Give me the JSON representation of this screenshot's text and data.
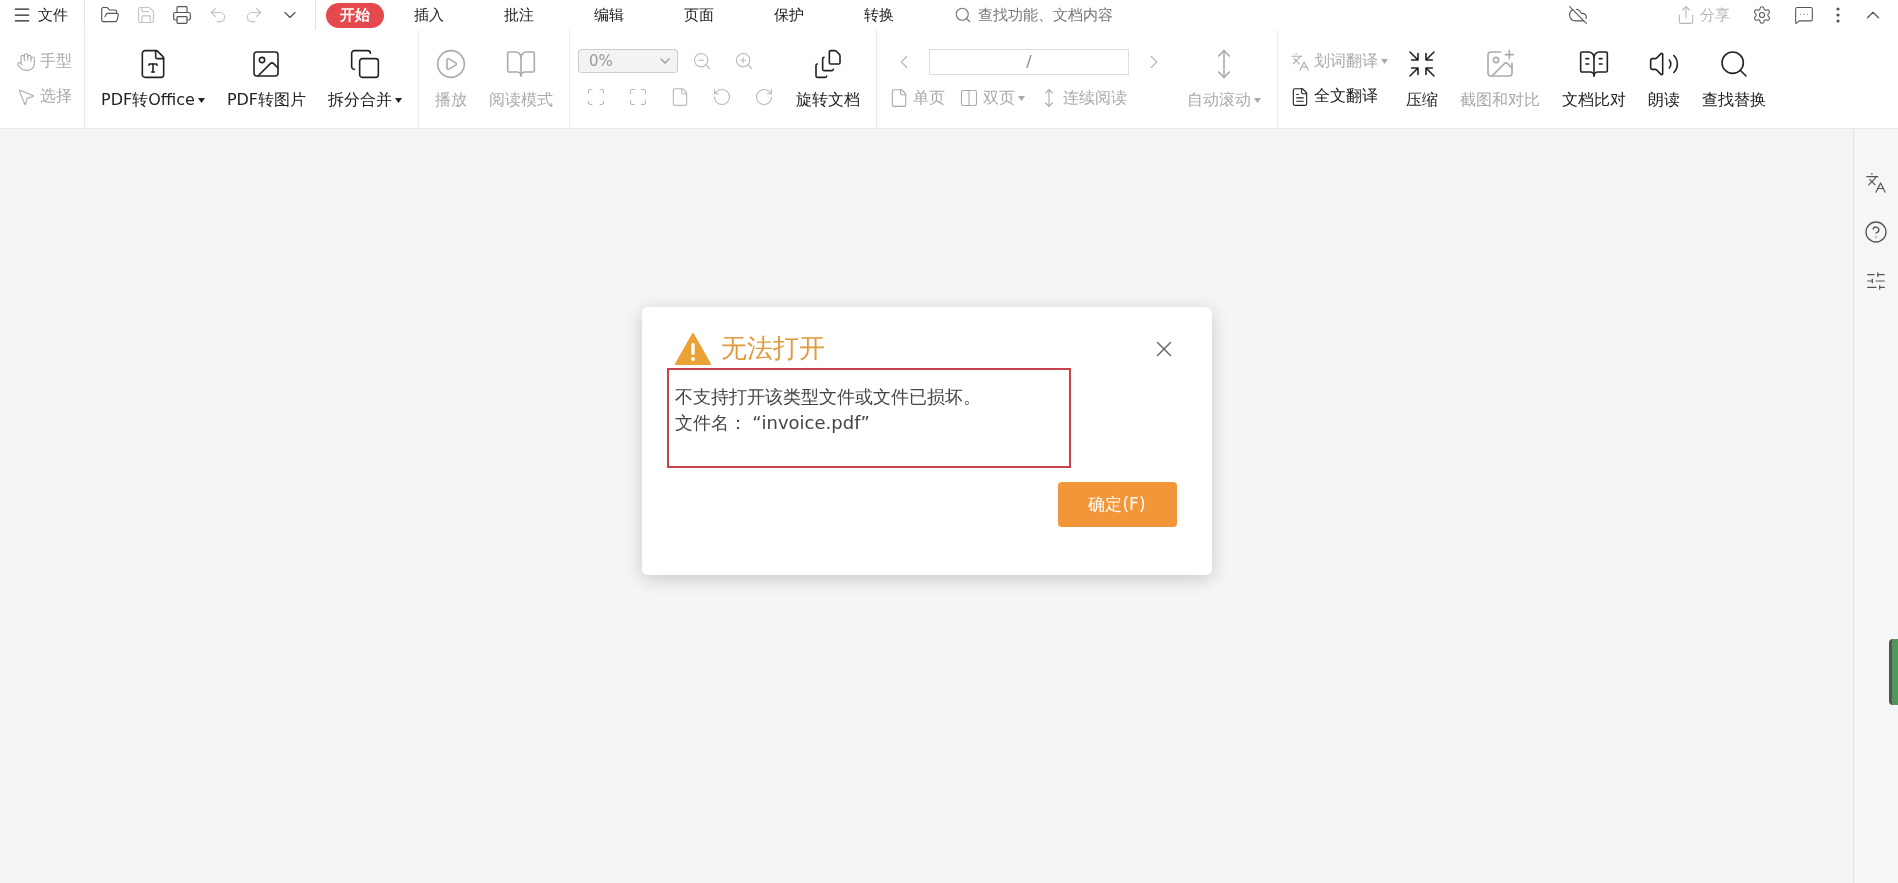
{
  "menu": {
    "label": "文件"
  },
  "quick_tools": [
    {
      "disabled": false
    },
    {
      "disabled": true
    },
    {
      "disabled": false
    },
    {
      "disabled": true
    },
    {
      "disabled": true
    },
    {
      "disabled": false
    }
  ],
  "tabs": [
    {
      "label": "开始",
      "selected": true
    },
    {
      "label": "插入",
      "selected": false
    },
    {
      "label": "批注",
      "selected": false
    },
    {
      "label": "编辑",
      "selected": false
    },
    {
      "label": "页面",
      "selected": false
    },
    {
      "label": "保护",
      "selected": false
    },
    {
      "label": "转换",
      "selected": false
    }
  ],
  "search": {
    "placeholder": "查找功能、文档内容"
  },
  "share": {
    "label": "分享",
    "disabled": true
  },
  "ribbon": [
    {
      "kind": "stack",
      "items": [
        {
          "label": "手型",
          "disabled": true,
          "dropdown": false
        },
        {
          "label": "选择",
          "disabled": true,
          "dropdown": false
        }
      ]
    },
    {
      "kind": "big",
      "items": [
        {
          "label": "PDF转Office",
          "disabled": false,
          "dropdown": true
        },
        {
          "label": "PDF转图片",
          "disabled": false,
          "dropdown": false
        },
        {
          "label": "拆分合并",
          "disabled": false,
          "dropdown": true
        }
      ]
    },
    {
      "kind": "big",
      "items": [
        {
          "label": "播放",
          "disabled": true,
          "dropdown": false
        },
        {
          "label": "阅读模式",
          "disabled": true,
          "dropdown": false
        }
      ]
    },
    {
      "kind": "zoom",
      "field": {
        "value": "0%",
        "disabled": true
      },
      "items": [
        {
          "label": "旋转文档",
          "disabled": false,
          "dropdown": false
        }
      ]
    },
    {
      "kind": "pagenav",
      "field": {
        "value": "/"
      },
      "row": [
        {
          "label": "单页",
          "disabled": true,
          "dropdown": false
        },
        {
          "label": "双页",
          "disabled": true,
          "dropdown": true
        },
        {
          "label": "连续阅读",
          "disabled": true,
          "dropdown": false
        }
      ],
      "items": [
        {
          "label": "自动滚动",
          "disabled": true,
          "dropdown": true
        }
      ]
    },
    {
      "kind": "translate",
      "stack": [
        {
          "label": "划词翻译",
          "disabled": true,
          "dropdown": true
        },
        {
          "label": "全文翻译",
          "disabled": false,
          "dropdown": false
        }
      ],
      "items": [
        {
          "label": "压缩",
          "disabled": false,
          "dropdown": false
        },
        {
          "label": "截图和对比",
          "disabled": true,
          "dropdown": false
        },
        {
          "label": "文档比对",
          "disabled": false,
          "dropdown": false
        },
        {
          "label": "朗读",
          "disabled": false,
          "dropdown": false
        },
        {
          "label": "查找替换",
          "disabled": false,
          "dropdown": false
        }
      ]
    }
  ],
  "dialog": {
    "title": "无法打开",
    "message": "不支持打开该类型文件或文件已损坏。",
    "filename": "文件名：  “invoice.pdf”",
    "button": "确定(F)"
  }
}
